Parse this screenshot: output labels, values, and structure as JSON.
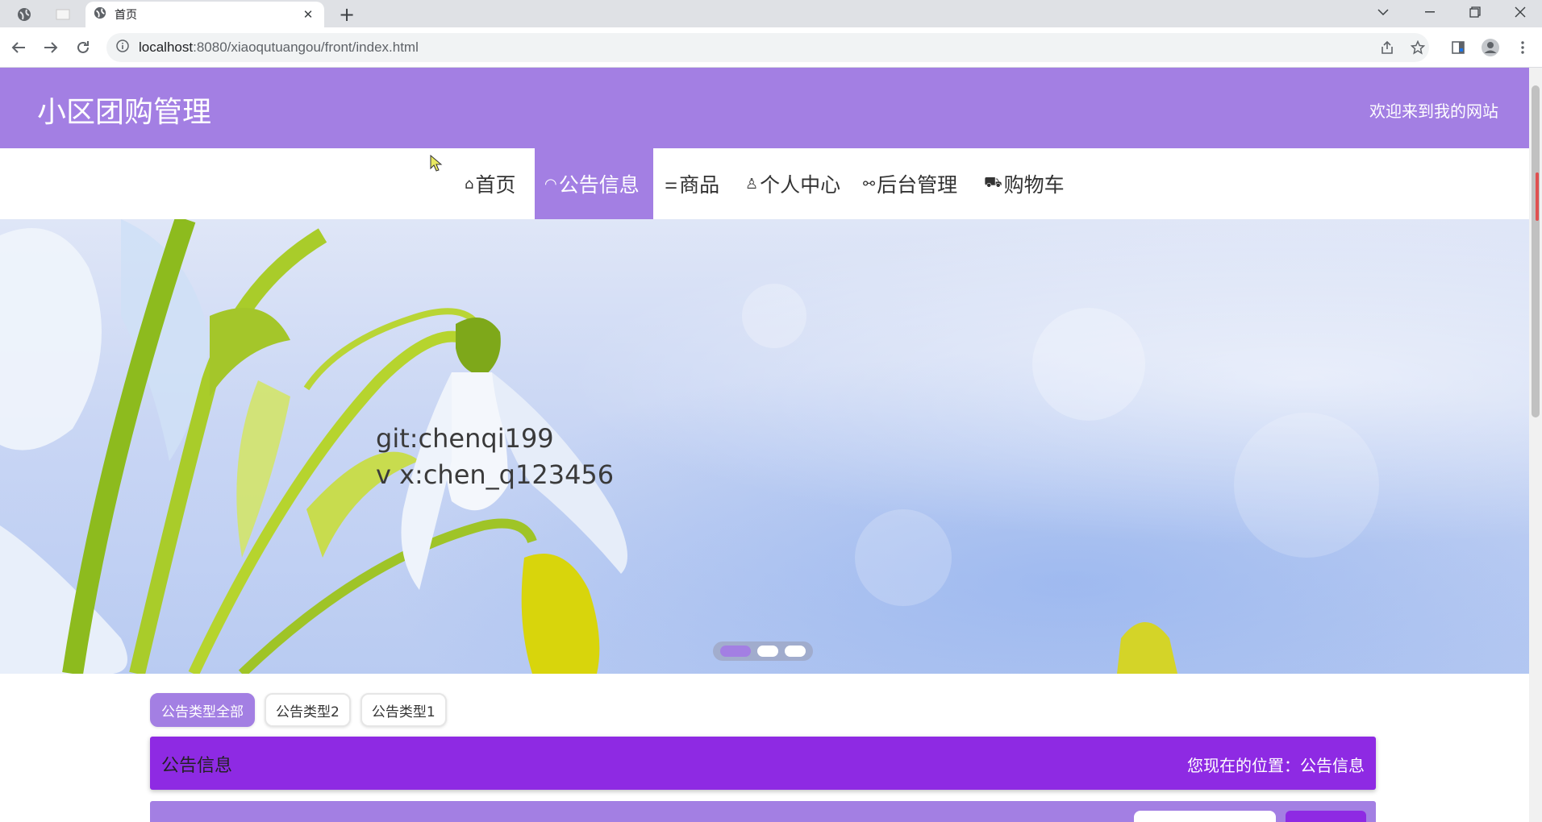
{
  "browser": {
    "tab_title": "首页",
    "tab_close": "✕",
    "new_tab": "+",
    "url_host": "localhost",
    "url_path": ":8080/xiaoqutuangou/front/index.html"
  },
  "site": {
    "title": "小区团购管理",
    "welcome": "欢迎来到我的网站"
  },
  "nav": {
    "items": [
      {
        "label": "首页",
        "icon": "⌂"
      },
      {
        "label": "公告信息",
        "icon": "◠"
      },
      {
        "label": "商品",
        "icon": "⚌"
      },
      {
        "label": "个人中心",
        "icon": "♙"
      },
      {
        "label": "后台管理",
        "icon": "⚯"
      },
      {
        "label": "购物车",
        "icon": "⛟"
      }
    ],
    "active_index": 1
  },
  "banner": {
    "line1": "git:chenqi199",
    "line2": "v x:chen_q123456",
    "active_slide": 1,
    "slide_count": 3
  },
  "filters": {
    "items": [
      "公告类型全部",
      "公告类型2",
      "公告类型1"
    ],
    "active_index": 0
  },
  "section": {
    "title": "公告信息",
    "location": "您现在的位置：公告信息"
  },
  "colors": {
    "primary": "#a37fe3",
    "section": "#8e2ae3"
  }
}
